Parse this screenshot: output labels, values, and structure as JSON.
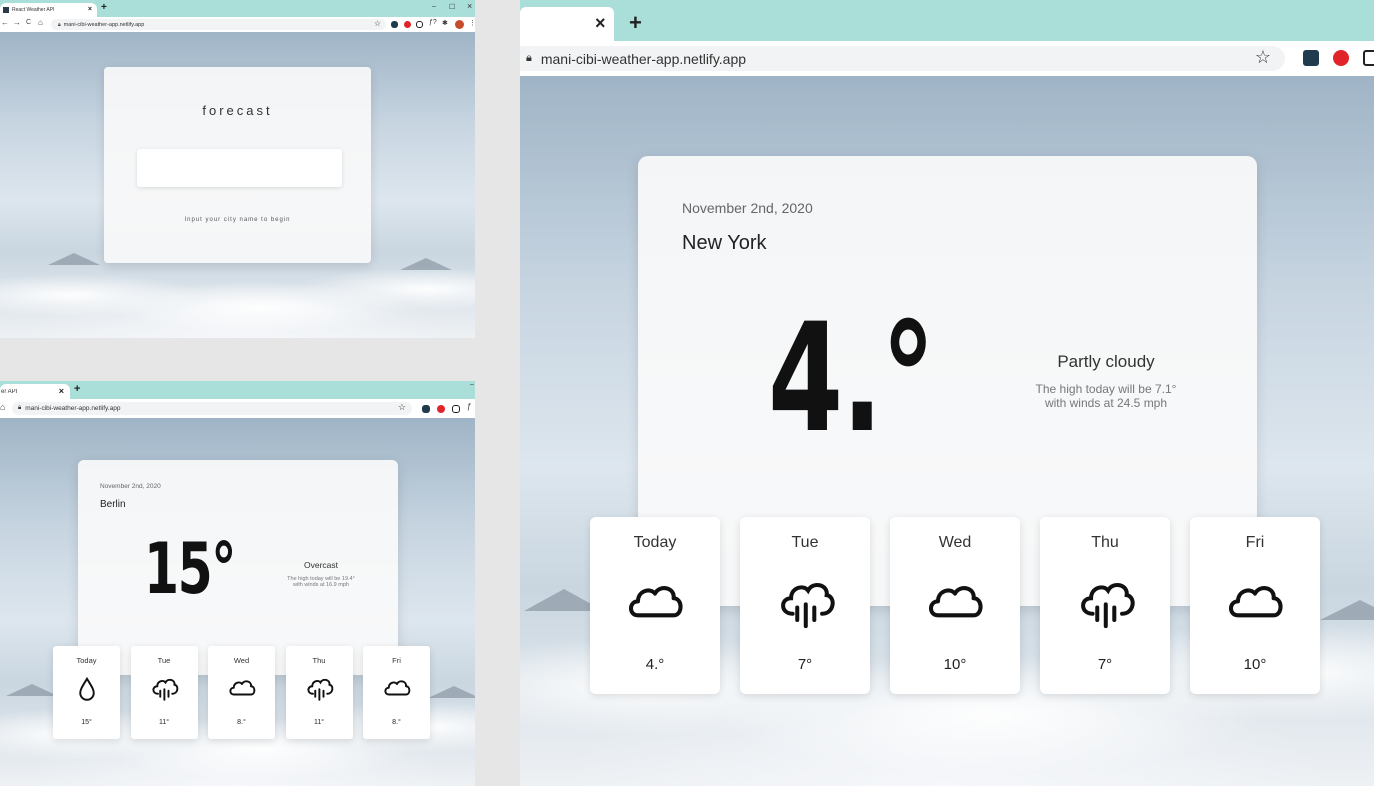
{
  "browser": {
    "tab_title": "React Weather API",
    "tab_title_partial": "er API",
    "address": "mani-cibi-weather-app.netlify.app",
    "new_tab": "+",
    "close": "×",
    "min": "–",
    "max": "☐",
    "win_close": "×",
    "nav": {
      "back": "←",
      "forward": "→",
      "reload": "C",
      "home": "⌂"
    },
    "star": "☆",
    "ext_icons": [
      "react-icon",
      "opera-icon",
      "notion-icon",
      "ruby-icon",
      "puzzle-icon",
      "profile-avatar"
    ]
  },
  "home": {
    "brand": "forecast",
    "search_placeholder": "",
    "hint": "Input your city name to begin"
  },
  "berlin": {
    "date": "November 2nd, 2020",
    "city": "Berlin",
    "temp": "15°",
    "condition": "Overcast",
    "desc_line1": "The high today will be 19.4°",
    "desc_line2": "with winds at 16.9 mph",
    "forecast": [
      {
        "day": "Today",
        "icon": "drop-icon",
        "temp": "15°"
      },
      {
        "day": "Tue",
        "icon": "rain-cloud-icon",
        "temp": "11°"
      },
      {
        "day": "Wed",
        "icon": "cloud-icon",
        "temp": "8.°"
      },
      {
        "day": "Thu",
        "icon": "rain-cloud-icon",
        "temp": "11°"
      },
      {
        "day": "Fri",
        "icon": "cloud-icon",
        "temp": "8.°"
      }
    ]
  },
  "newyork": {
    "date": "November 2nd, 2020",
    "city": "New York",
    "temp": "4.°",
    "condition": "Partly cloudy",
    "desc_line1": "The high today will be 7.1°",
    "desc_line2": "with winds at 24.5 mph",
    "forecast": [
      {
        "day": "Today",
        "icon": "cloud-icon",
        "temp": "4.°"
      },
      {
        "day": "Tue",
        "icon": "rain-cloud-icon",
        "temp": "7°"
      },
      {
        "day": "Wed",
        "icon": "cloud-icon",
        "temp": "10°"
      },
      {
        "day": "Thu",
        "icon": "rain-cloud-icon",
        "temp": "7°"
      },
      {
        "day": "Fri",
        "icon": "cloud-icon",
        "temp": "10°"
      }
    ]
  },
  "colors": {
    "tabstrip": "#aadfd9",
    "card": "#fafafa",
    "text": "#222222"
  }
}
